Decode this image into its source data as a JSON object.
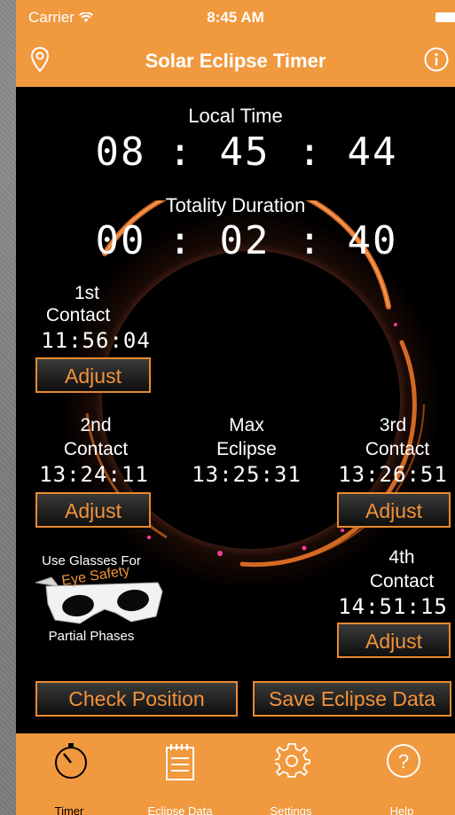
{
  "status_bar": {
    "carrier": "Carrier",
    "time": "8:45 AM"
  },
  "nav": {
    "title": "Solar Eclipse Timer",
    "left_icon": "location-pin-icon",
    "right_icon": "info-icon"
  },
  "local_time": {
    "label": "Local Time",
    "hours": "08",
    "sep1": ":",
    "minutes": "45",
    "sep2": ":",
    "seconds": "44"
  },
  "totality": {
    "label": "Totality Duration",
    "hours": "00",
    "sep1": ":",
    "minutes": "02",
    "sep2": ":",
    "seconds": "40"
  },
  "contacts": {
    "first": {
      "line1": "1st",
      "line2": "Contact",
      "time": "11:56:04",
      "button": "Adjust"
    },
    "second": {
      "line1": "2nd",
      "line2": "Contact",
      "time": "13:24:11",
      "button": "Adjust"
    },
    "max": {
      "line1": "Max",
      "line2": "Eclipse",
      "time": "13:25:31"
    },
    "third": {
      "line1": "3rd",
      "line2": "Contact",
      "time": "13:26:51",
      "button": "Adjust"
    },
    "fourth": {
      "line1": "4th",
      "line2": "Contact",
      "time": "14:51:15",
      "button": "Adjust"
    }
  },
  "safety": {
    "top": "Use Glasses For",
    "middle": "Eye Safety",
    "bottom": "Partial Phases"
  },
  "actions": {
    "check_position": "Check Position",
    "save_data": "Save Eclipse Data"
  },
  "tabs": [
    {
      "label": "Timer",
      "icon": "stopwatch-icon",
      "active": true
    },
    {
      "label": "Eclipse Data",
      "icon": "notepad-icon",
      "active": false
    },
    {
      "label": "Settings",
      "icon": "gear-icon",
      "active": false
    },
    {
      "label": "Help",
      "icon": "help-icon",
      "active": false
    }
  ],
  "colors": {
    "accent": "#f0993f",
    "button_text": "#f2923a",
    "background": "#000000"
  }
}
